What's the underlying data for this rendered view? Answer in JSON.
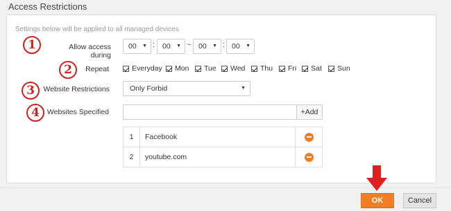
{
  "title": "Access Restrictions",
  "note": "Settings below will be applied to all managed devices",
  "markers": [
    "1",
    "2",
    "3",
    "4"
  ],
  "labels": {
    "allow_access": "Allow access during",
    "repeat": "Repeat",
    "website_restrictions": "Website Restrictions",
    "websites_specified": "Websites Specified"
  },
  "time": {
    "start_hour": "00",
    "start_minute": "00",
    "end_hour": "00",
    "end_minute": "00",
    "colon": ":",
    "tilde": "~"
  },
  "days": [
    "Everyday",
    "Mon",
    "Tue",
    "Wed",
    "Thu",
    "Fri",
    "Sat",
    "Sun"
  ],
  "restriction_mode": "Only Forbid",
  "site_input": {
    "value": "",
    "add_label": "+Add"
  },
  "sites": [
    {
      "index": "1",
      "name": "Facebook"
    },
    {
      "index": "2",
      "name": "youtube.com"
    }
  ],
  "buttons": {
    "ok": "OK",
    "cancel": "Cancel"
  },
  "colors": {
    "accent": "#f07f23",
    "marker": "#d02020",
    "arrow": "#e02020"
  },
  "icons": {
    "remove": "minus-circle-icon",
    "dropdown": "caret-down-icon",
    "pointer": "down-arrow-icon"
  }
}
